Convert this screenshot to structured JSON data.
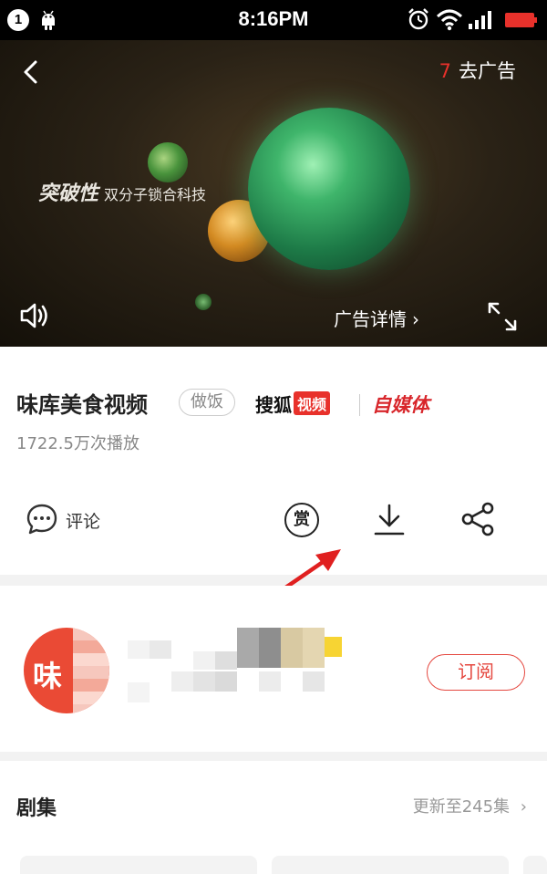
{
  "status_bar": {
    "notification_count": "1",
    "time": "8:16PM"
  },
  "video": {
    "ad_countdown": "7",
    "skip_label": "去广告",
    "ad_text_bold": "突破性",
    "ad_text_small": "双分子锁合科技",
    "ad_detail_label": "广告详情",
    "ad_detail_chevron": "›"
  },
  "info": {
    "title": "味库美食视频",
    "category_tag": "做饭",
    "source_brand": "搜狐",
    "source_brand_badge": "视频",
    "media_label": "自媒体",
    "view_count": "1722.5万次播放",
    "actions": {
      "comment_label": "评论",
      "reward_label": "赏"
    }
  },
  "author": {
    "avatar_text": "味",
    "subscribe_label": "订阅"
  },
  "episodes": {
    "title": "剧集",
    "update_label": "更新至245集",
    "chevron": "›"
  },
  "colors": {
    "accent_red": "#e8312b",
    "status_bar_bg": "#000000",
    "annotation_arrow": "#e02020"
  }
}
